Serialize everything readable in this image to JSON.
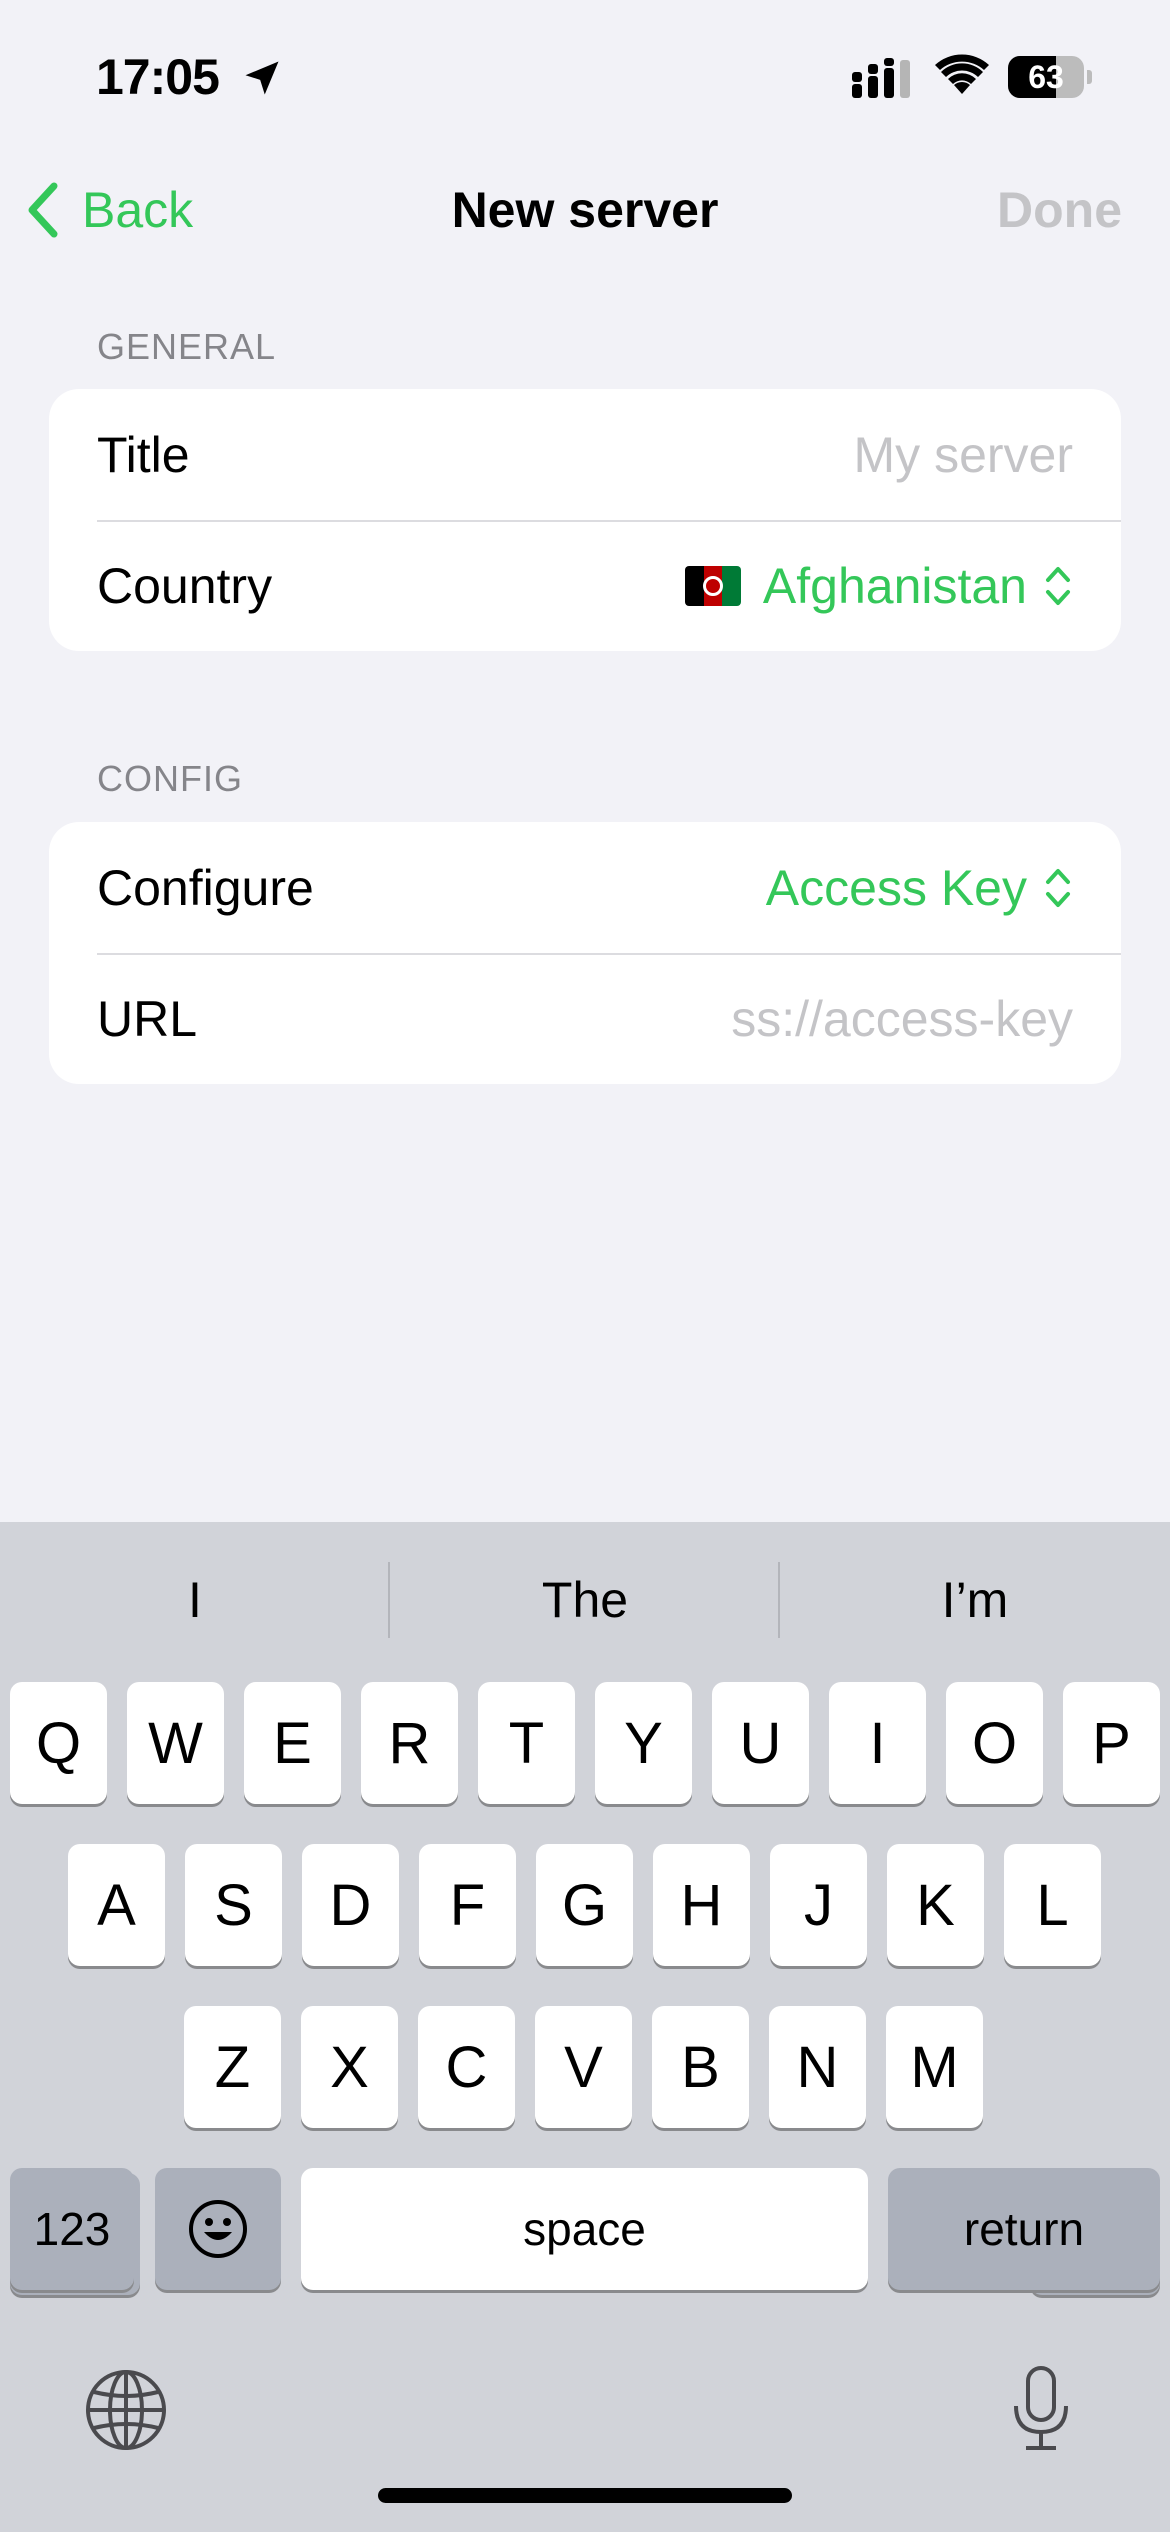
{
  "status_bar": {
    "time": "17:05",
    "battery_percent": 63,
    "battery_label": "63",
    "icons": [
      "location-arrow-icon",
      "cellular-signal-icon",
      "wifi-icon",
      "battery-icon"
    ]
  },
  "nav": {
    "back_label": "Back",
    "title": "New server",
    "done_label": "Done"
  },
  "colors": {
    "accent": "#34c759",
    "placeholder": "#c4c4c7",
    "section_header": "#85858a",
    "background": "#f2f2f7",
    "keyboard_bg": "#d1d3d9"
  },
  "general": {
    "header": "GENERAL",
    "title_label": "Title",
    "title_placeholder": "My server",
    "country_label": "Country",
    "country_value": "Afghanistan",
    "country_flag": "afghanistan-flag"
  },
  "config": {
    "header": "CONFIG",
    "configure_label": "Configure",
    "configure_value": "Access Key",
    "url_label": "URL",
    "url_placeholder": "ss://access-key"
  },
  "keyboard": {
    "suggestions": [
      "I",
      "The",
      "I’m"
    ],
    "row1": [
      "Q",
      "W",
      "E",
      "R",
      "T",
      "Y",
      "U",
      "I",
      "O",
      "P"
    ],
    "row2": [
      "A",
      "S",
      "D",
      "F",
      "G",
      "H",
      "J",
      "K",
      "L"
    ],
    "row3": [
      "Z",
      "X",
      "C",
      "V",
      "B",
      "N",
      "M"
    ],
    "numbers_label": "123",
    "space_label": "space",
    "return_label": "return"
  }
}
